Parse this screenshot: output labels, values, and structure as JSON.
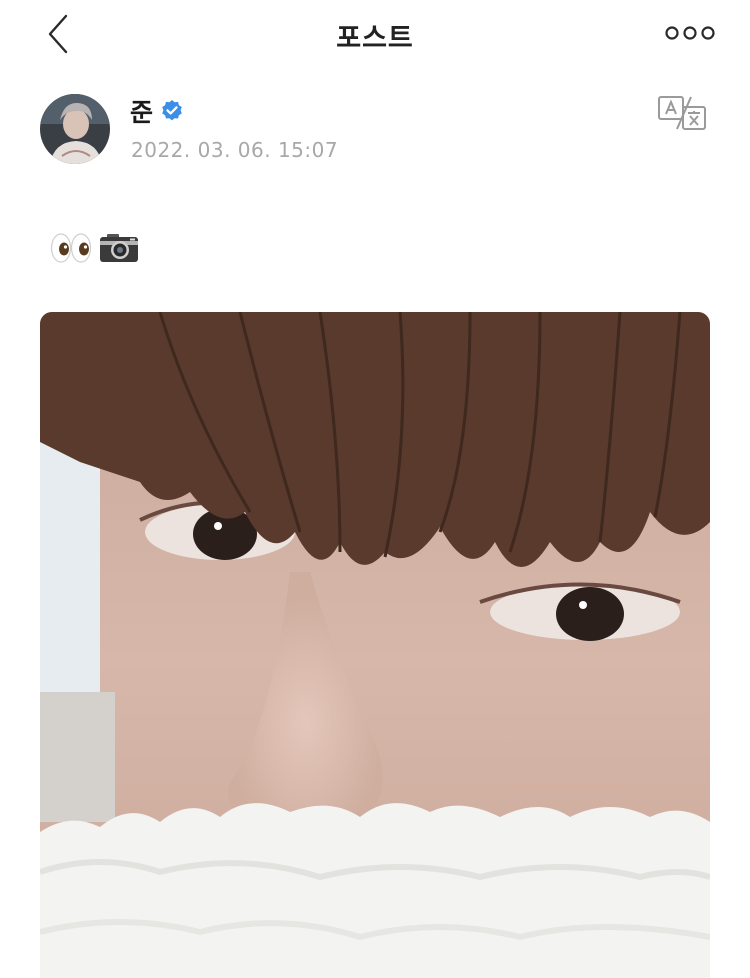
{
  "header": {
    "title": "포스트"
  },
  "post": {
    "author_name": "준",
    "timestamp": "2022. 03. 06. 15:07",
    "body_emojis": [
      "eyes-emoji",
      "camera-emoji"
    ]
  },
  "icons": {
    "back": "chevron-left-icon",
    "more": "more-options-icon",
    "verified": "verified-badge-icon",
    "translate": "translate-icon"
  },
  "colors": {
    "verified_blue": "#3b8fe8",
    "timestamp_gray": "#a8a8a8",
    "icon_gray": "#9a9a9a"
  }
}
